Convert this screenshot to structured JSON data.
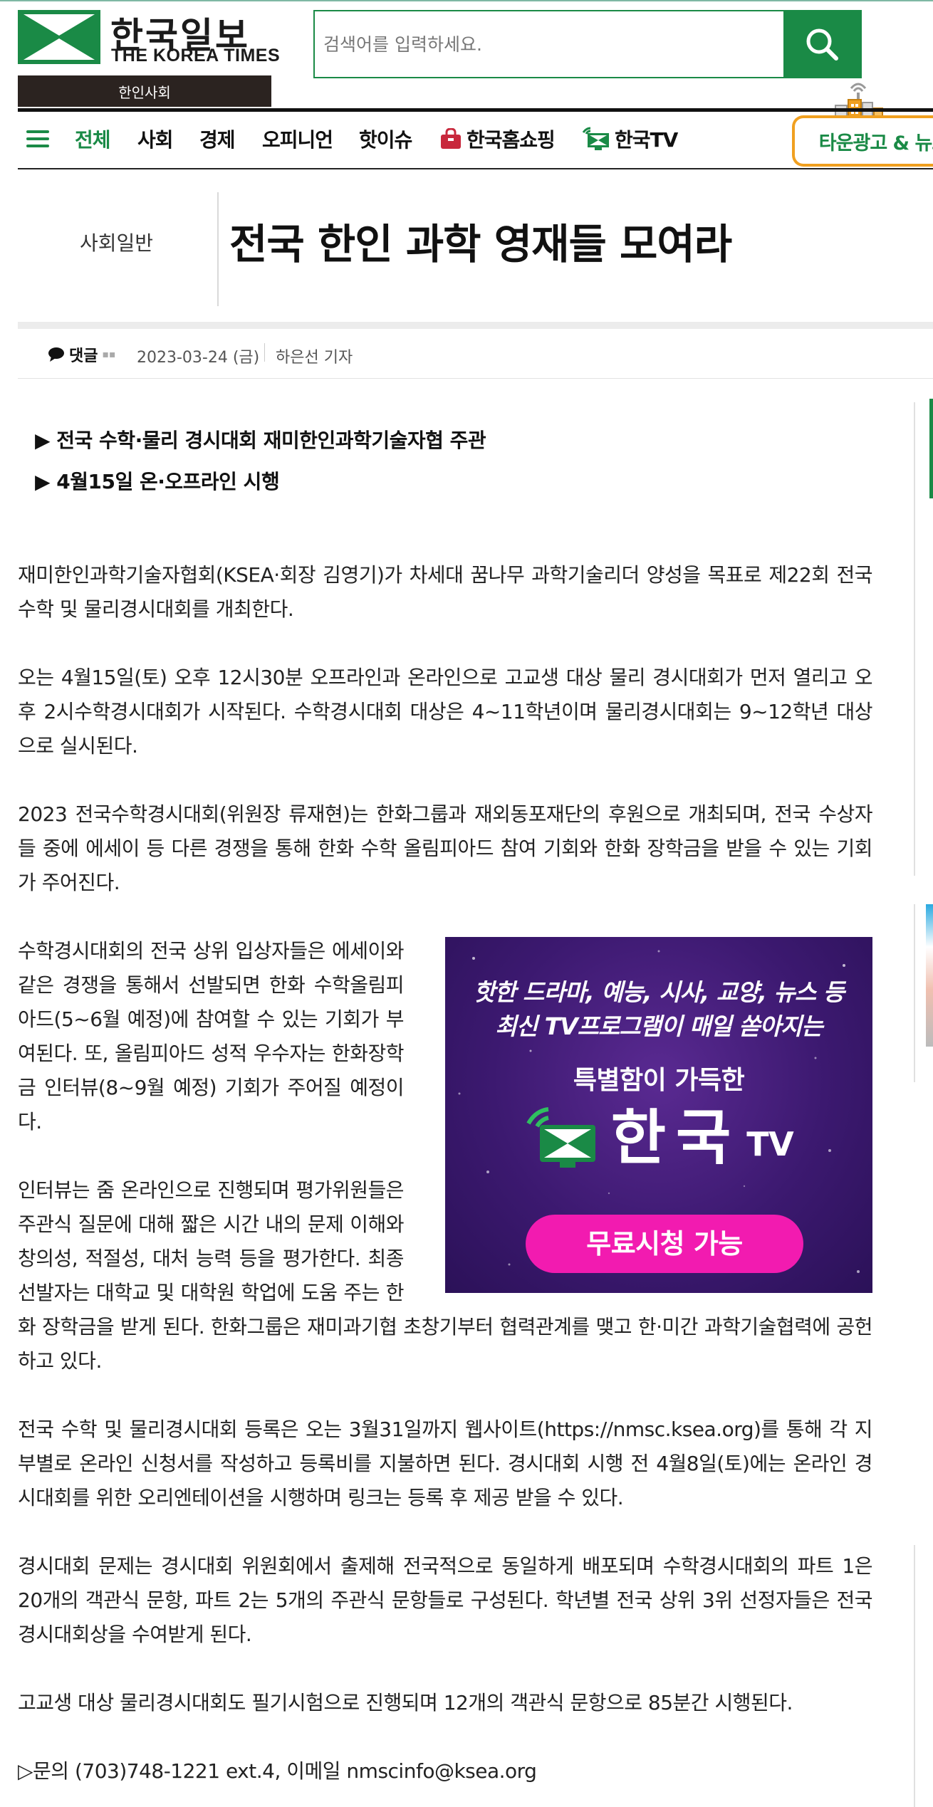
{
  "header": {
    "logo_ko": "한국일보",
    "logo_en": "THE KOREA TIMES",
    "section_badge": "한인사회",
    "search_placeholder": "검색어를 입력하세요."
  },
  "nav": {
    "items": [
      "전체",
      "사회",
      "경제",
      "오피니언",
      "핫이슈",
      "한국홈쇼핑",
      "한국TV"
    ],
    "town_button": "타운광고 & 뉴스"
  },
  "article": {
    "category": "사회일반",
    "title": "전국 한인 과학 영재들 모여라",
    "comment_label": "댓글",
    "date": "2023-03-24 (금)",
    "author": "하은선 기자",
    "subheads": [
      "▶ 전국 수학·물리 경시대회 재미한인과학기술자협 주관",
      "▶ 4월15일 온·오프라인 시행"
    ],
    "paragraphs": [
      "재미한인과학기술자협회(KSEA·회장 김영기)가 차세대 꿈나무 과학기술리더 양성을 목표로 제22회 전국 수학 및 물리경시대회를 개최한다.",
      "오는 4월15일(토) 오후 12시30분 오프라인과 온라인으로 고교생 대상 물리 경시대회가 먼저 열리고 오후 2시수학경시대회가 시작된다. 수학경시대회 대상은 4~11학년이며 물리경시대회는 9~12학년 대상으로 실시된다.",
      "2023 전국수학경시대회(위원장 류재현)는 한화그룹과 재외동포재단의 후원으로 개최되며, 전국 수상자들 중에 에세이 등 다른 경쟁을 통해 한화 수학 올림피아드 참여 기회와 한화 장학금을 받을 수 있는 기회가 주어진다.",
      "수학경시대회의 전국 상위 입상자들은 에세이와 같은 경쟁을 통해서 선발되면 한화 수학올림피아드(5~6월 예정)에 참여할 수 있는 기회가 부여된다. 또, 올림피아드 성적 우수자는 한화장학금 인터뷰(8~9월 예정) 기회가 주어질 예정이다.",
      "인터뷰는 줌 온라인으로 진행되며 평가위원들은 주관식 질문에 대해 짧은 시간 내의 문제 이해와 창의성, 적절성, 대처 능력 등을 평가한다. 최종 선발자는 대학교 및 대학원 학업에 도움 주는 한화 장학금을 받게 된다. 한화그룹은 재미과기협 초창기부터 협력관계를 맺고 한·미간 과학기술협력에 공헌하고 있다.",
      "전국 수학 및 물리경시대회 등록은 오는 3월31일까지 웹사이트(https://nmsc.ksea.org)를 통해 각 지부별로 온라인 신청서를 작성하고 등록비를 지불하면 된다. 경시대회 시행 전 4월8일(토)에는 온라인 경시대회를 위한 오리엔테이션을 시행하며 링크는 등록 후 제공 받을 수 있다.",
      "경시대회 문제는 경시대회 위원회에서 출제해 전국적으로 동일하게 배포되며 수학경시대회의 파트 1은 20개의 객관식 문항, 파트 2는 5개의 주관식 문항들로 구성된다. 학년별 전국 상위 3위 선정자들은 전국 경시대회상을 수여받게 된다.",
      "고교생 대상 물리경시대회도 필기시험으로 진행되며 12개의 객관식 문항으로 85분간 시행된다.",
      "▷문의 (703)748-1221 ext.4, 이메일 nmscinfo@ksea.org"
    ]
  },
  "ad": {
    "line1": "핫한 드라마, 예능, 시사, 교양, 뉴스 등",
    "line2": "최신 TV프로그램이 매일 쏟아지는",
    "line3": "특별함이 가득한",
    "brand": "한국",
    "brand_suffix": "TV",
    "cta": "무료시청 가능"
  },
  "colors": {
    "brand_green": "#1a8a46",
    "badge_dark": "#2b2320",
    "town_orange": "#f0a020",
    "ad_purple": "#3c1970",
    "ad_pink": "#f21bb0",
    "shopping_red": "#c8283c"
  },
  "icons": [
    "search-icon",
    "hamburger-menu-icon",
    "shopping-bag-icon",
    "tv-icon",
    "town-building-icon",
    "comment-bubble-icon"
  ]
}
